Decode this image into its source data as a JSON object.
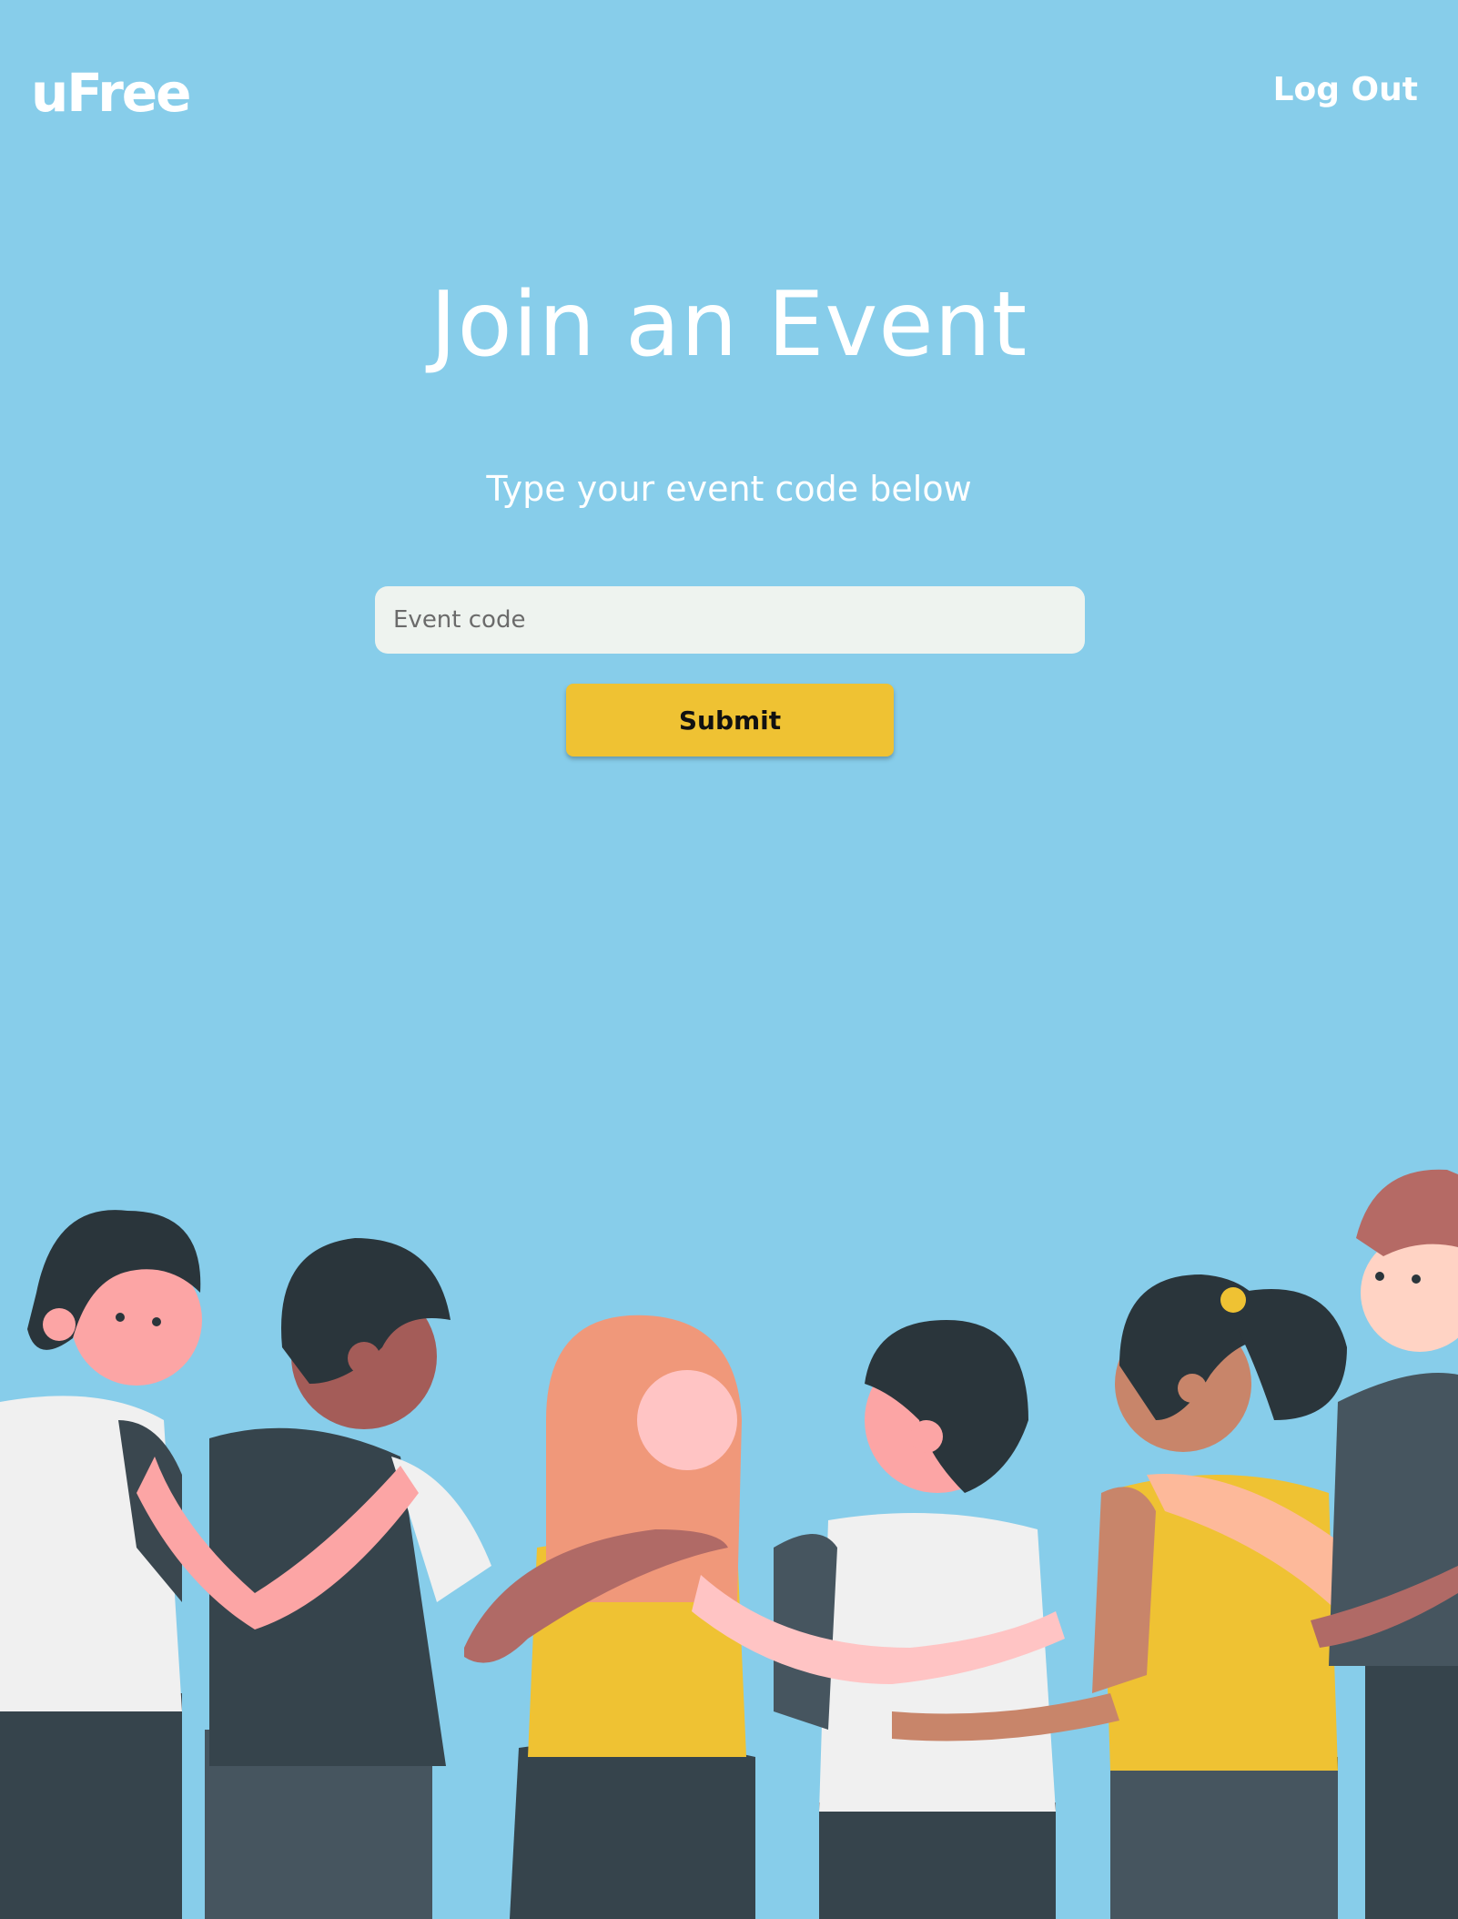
{
  "header": {
    "logo": "uFree",
    "logout_label": "Log Out"
  },
  "main": {
    "title": "Join an Event",
    "subtitle": "Type your event code below",
    "code_input": {
      "value": "",
      "placeholder": "Event code"
    },
    "submit_label": "Submit"
  },
  "colors": {
    "background": "#87cdea",
    "button": "#efc233",
    "input": "#eef3ef"
  },
  "illustration": "group-of-friends-hugging"
}
